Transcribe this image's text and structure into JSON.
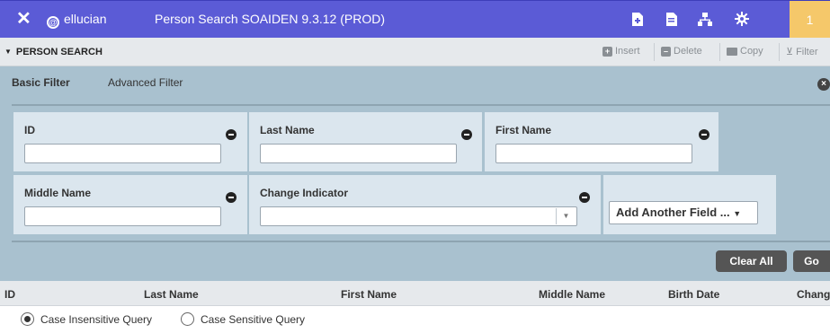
{
  "header": {
    "close_glyph": "✕",
    "brand": "ellucian",
    "title": "Person Search SOAIDEN 9.3.12 (PROD)",
    "icons": [
      "new-document-icon",
      "print-icon",
      "hierarchy-icon",
      "settings-gear-icon"
    ],
    "counter": "1"
  },
  "section": {
    "title": "PERSON SEARCH",
    "tools": {
      "insert": "Insert",
      "delete": "Delete",
      "copy": "Copy",
      "filter": "Filter"
    }
  },
  "filter": {
    "tabs": {
      "basic": "Basic Filter",
      "advanced": "Advanced Filter"
    },
    "fields": {
      "id": {
        "label": "ID",
        "value": ""
      },
      "last_name": {
        "label": "Last Name",
        "value": ""
      },
      "first_name": {
        "label": "First Name",
        "value": ""
      },
      "middle_name": {
        "label": "Middle Name",
        "value": ""
      },
      "change_indicator": {
        "label": "Change Indicator",
        "value": ""
      }
    },
    "add_field": "Add Another Field ...",
    "clear_all": "Clear All",
    "go": "Go"
  },
  "results": {
    "columns": [
      "ID",
      "Last Name",
      "First Name",
      "Middle Name",
      "Birth Date",
      "Chang"
    ]
  },
  "query_mode": {
    "options": [
      "Case Insensitive Query",
      "Case Sensitive Query"
    ],
    "selected": "Case Insensitive Query"
  },
  "colors": {
    "header_bg": "#5b5bd6",
    "filter_bg": "#a9c1cf",
    "counter_bg": "#f5c86a"
  }
}
